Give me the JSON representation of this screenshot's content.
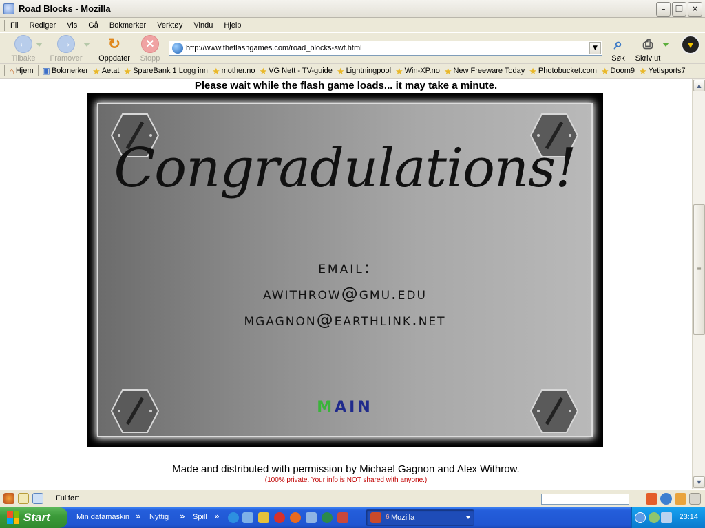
{
  "window": {
    "title": "Road Blocks - Mozilla"
  },
  "menu": [
    "Fil",
    "Rediger",
    "Vis",
    "Gå",
    "Bokmerker",
    "Verktøy",
    "Vindu",
    "Hjelp"
  ],
  "toolbar": {
    "back_label": "Tilbake",
    "forward_label": "Framover",
    "reload_label": "Oppdater",
    "stop_label": "Stopp",
    "search_label": "Søk",
    "print_label": "Skriv ut"
  },
  "urlbar": {
    "url": "http://www.theflashgames.com/road_blocks-swf.html"
  },
  "bookmarks": {
    "home": "Hjem",
    "bookmarks": "Bokmerker",
    "items": [
      "Aetat",
      "SpareBank 1 Logg inn",
      "mother.no",
      "VG Nett - TV-guide",
      "Lightningpool",
      "Win-XP.no",
      "New Freeware Today",
      "Photobucket.com",
      "Doom9",
      "Yetisports7"
    ]
  },
  "page": {
    "loading_text": "Please wait while the flash game loads... it may take a minute.",
    "game": {
      "heading": "Congradulations!",
      "email_label": "email:",
      "emails": [
        "awithrow@gmu.edu",
        "mgagnon@earthlink.net"
      ],
      "main_first": "M",
      "main_rest": "AIN"
    },
    "credit": "Made and distributed with permission by Michael Gagnon and Alex Withrow.",
    "privacy": "(100% private. Your info is NOT shared with anyone.)"
  },
  "status": {
    "text": "Fullført"
  },
  "taskbar": {
    "start": "Start",
    "items": [
      "Min datamaskin",
      "Nyttig",
      "Spill"
    ],
    "task_label": "Mozilla",
    "task_count": "6",
    "clock": "23:14"
  },
  "colors": {
    "main_first_letter": "#3ab43a",
    "main_rest": "#1f2a8c",
    "privacy": "#c00000",
    "taskbar": "#245edb",
    "start_button": "#3c9b3a"
  }
}
